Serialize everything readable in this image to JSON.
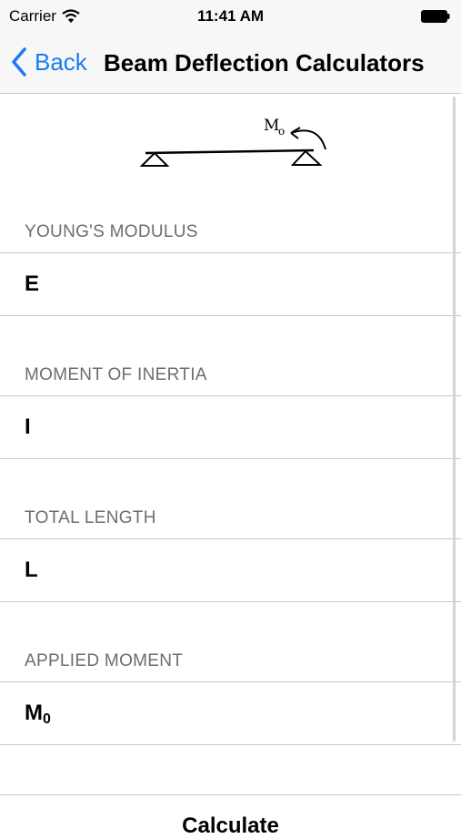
{
  "status_bar": {
    "carrier": "Carrier",
    "time": "11:41 AM"
  },
  "nav": {
    "back_label": "Back",
    "title": "Beam Deflection Calculators"
  },
  "diagram": {
    "moment_label": "M",
    "moment_sub": "o"
  },
  "sections": [
    {
      "header": "YOUNG'S MODULUS",
      "label": "E",
      "value": ""
    },
    {
      "header": "MOMENT OF INERTIA",
      "label": "I",
      "value": ""
    },
    {
      "header": "TOTAL LENGTH",
      "label": "L",
      "value": ""
    },
    {
      "header": "APPLIED MOMENT",
      "label": "M",
      "label_sub": "0",
      "value": ""
    }
  ],
  "calculate_label": "Calculate"
}
